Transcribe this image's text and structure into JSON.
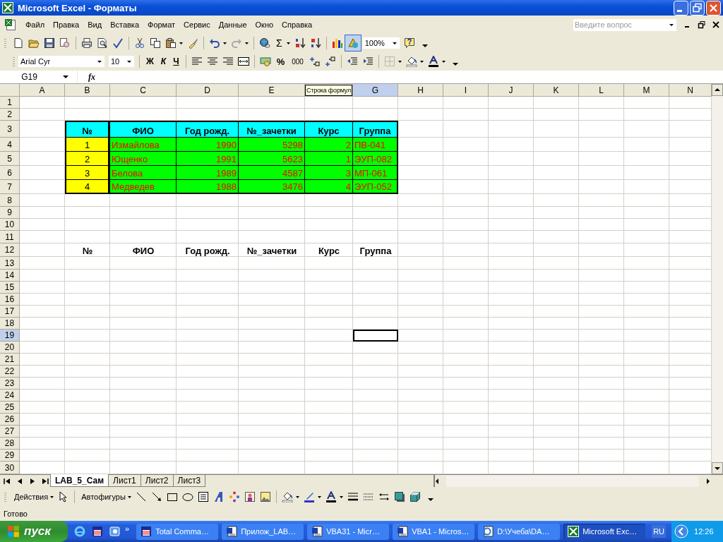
{
  "window": {
    "title": "Microsoft Excel - Форматы"
  },
  "menu": [
    "Файл",
    "Правка",
    "Вид",
    "Вставка",
    "Формат",
    "Сервис",
    "Данные",
    "Окно",
    "Справка"
  ],
  "help_search": {
    "placeholder": "Введите вопрос"
  },
  "standard_toolbar": {
    "sum": "Σ",
    "zoom": "100%"
  },
  "formatting_toolbar": {
    "font": "Arial Cyr",
    "size": "10",
    "bold": "Ж",
    "italic": "К",
    "underline": "Ч",
    "percent": "%",
    "thousands": "000"
  },
  "formula_bar": {
    "name_box": "G19",
    "fx": "fx",
    "tooltip": "Строка формул"
  },
  "columns": [
    {
      "label": "A",
      "selected": false
    },
    {
      "label": "B",
      "selected": false
    },
    {
      "label": "C",
      "selected": false
    },
    {
      "label": "D",
      "selected": false
    },
    {
      "label": "E",
      "selected": false
    },
    {
      "selected": false
    },
    {
      "label": "G",
      "selected": true
    },
    {
      "label": "H",
      "selected": false
    },
    {
      "label": "I",
      "selected": false
    },
    {
      "label": "J",
      "selected": false
    },
    {
      "label": "K",
      "selected": false
    },
    {
      "label": "L",
      "selected": false
    },
    {
      "label": "M",
      "selected": false
    },
    {
      "label": "N",
      "selected": false
    }
  ],
  "rows": [
    {
      "label": "1",
      "selected": false
    },
    {
      "label": "2",
      "selected": false
    },
    {
      "label": "3",
      "selected": false
    },
    {
      "label": "4",
      "selected": false
    },
    {
      "label": "5",
      "selected": false
    },
    {
      "label": "6",
      "selected": false
    },
    {
      "label": "7",
      "selected": false
    },
    {
      "label": "8",
      "selected": false
    },
    {
      "label": "9",
      "selected": false
    },
    {
      "label": "10",
      "selected": false
    },
    {
      "label": "11",
      "selected": false
    },
    {
      "label": "12",
      "selected": false
    },
    {
      "label": "13",
      "selected": false
    },
    {
      "label": "14",
      "selected": false
    },
    {
      "label": "15",
      "selected": false
    },
    {
      "label": "16",
      "selected": false
    },
    {
      "label": "17",
      "selected": false
    },
    {
      "label": "18",
      "selected": false
    },
    {
      "label": "19",
      "selected": true
    },
    {
      "label": "20",
      "selected": false
    },
    {
      "label": "21",
      "selected": false
    },
    {
      "label": "22",
      "selected": false
    },
    {
      "label": "23",
      "selected": false
    },
    {
      "label": "24",
      "selected": false
    },
    {
      "label": "25",
      "selected": false
    },
    {
      "label": "26",
      "selected": false
    },
    {
      "label": "27",
      "selected": false
    },
    {
      "label": "28",
      "selected": false
    },
    {
      "label": "29",
      "selected": false
    },
    {
      "label": "30",
      "selected": false
    }
  ],
  "table": {
    "header": [
      "№",
      "ФИО",
      "Год рожд.",
      "№_зачетки",
      "Курс",
      "Группа"
    ],
    "rows": [
      [
        "1",
        "Измайлова",
        "1990",
        "5298",
        "2",
        "ПВ-041"
      ],
      [
        "2",
        "Ющенко",
        "1991",
        "5623",
        "1",
        "ЭУП-082"
      ],
      [
        "3",
        "Белова",
        "1989",
        "4587",
        "3",
        "МП-061"
      ],
      [
        "4",
        "Медведев",
        "1988",
        "3476",
        "4",
        "ЭУП-052"
      ]
    ]
  },
  "copy_header": [
    "№",
    "ФИО",
    "Год рожд.",
    "№_зачетки",
    "Курс",
    "Группа"
  ],
  "sheet_tabs": [
    {
      "label": "LAB_5_Сам",
      "selected": true
    },
    {
      "label": "Лист1",
      "selected": false
    },
    {
      "label": "Лист2",
      "selected": false
    },
    {
      "label": "Лист3",
      "selected": false
    }
  ],
  "drawing_toolbar": {
    "actions": "Действия",
    "autoshapes": "Автофигуры"
  },
  "status_bar": {
    "text": "Готово"
  },
  "taskbar": {
    "start": "пуск",
    "more": "»",
    "buttons": [
      {
        "label": "Total Comma…",
        "kind": "floppy",
        "selected": false
      },
      {
        "label": "Прилож_LAB…",
        "kind": "word",
        "selected": false
      },
      {
        "label": "VBA31 - Micr…",
        "kind": "word",
        "selected": false
      },
      {
        "label": "VBA1 - Micros…",
        "kind": "word",
        "selected": false
      },
      {
        "label": "D:\\Учеба\\DA…",
        "kind": "browser",
        "selected": false
      },
      {
        "label": "Microsoft Exc…",
        "kind": "excel",
        "selected": true
      }
    ],
    "language": "RU",
    "clock": "12:26"
  }
}
